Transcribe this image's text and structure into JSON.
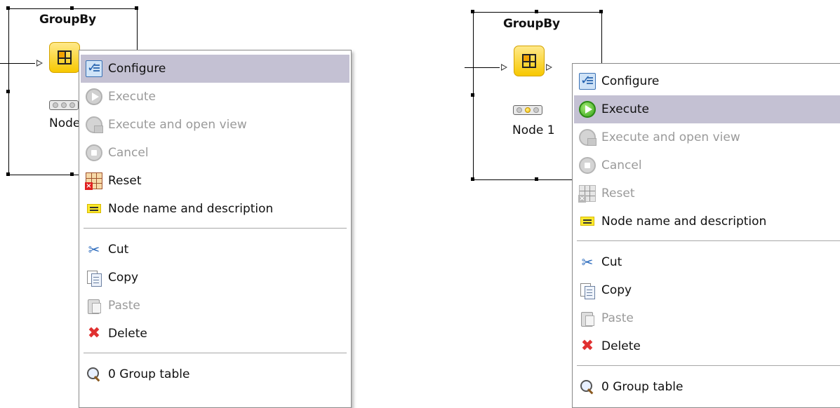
{
  "panels": [
    {
      "node": {
        "title": "GroupBy",
        "label": "Node",
        "status_lights": [
          "off",
          "off",
          "off"
        ]
      },
      "menu": {
        "items": [
          {
            "label": "Configure",
            "icon": "configure-icon",
            "enabled": true,
            "highlighted": true
          },
          {
            "label": "Execute",
            "icon": "execute-icon",
            "enabled": false,
            "highlighted": false
          },
          {
            "label": "Execute and open view",
            "icon": "execute-open-view-icon",
            "enabled": false,
            "highlighted": false
          },
          {
            "label": "Cancel",
            "icon": "cancel-icon",
            "enabled": false,
            "highlighted": false
          },
          {
            "label": "Reset",
            "icon": "reset-icon",
            "enabled": true,
            "highlighted": false
          },
          {
            "label": "Node name and description",
            "icon": "note-icon",
            "enabled": true,
            "highlighted": false
          },
          {
            "label": "Cut",
            "icon": "scissors-icon",
            "enabled": true,
            "highlighted": false
          },
          {
            "label": "Copy",
            "icon": "copy-icon",
            "enabled": true,
            "highlighted": false
          },
          {
            "label": "Paste",
            "icon": "paste-icon",
            "enabled": false,
            "highlighted": false
          },
          {
            "label": "Delete",
            "icon": "delete-icon",
            "enabled": true,
            "highlighted": false
          },
          {
            "label": "0 Group table",
            "icon": "magnifier-icon",
            "enabled": true,
            "highlighted": false
          }
        ]
      }
    },
    {
      "node": {
        "title": "GroupBy",
        "label": "Node 1",
        "status_lights": [
          "off",
          "yellow",
          "off"
        ]
      },
      "menu": {
        "items": [
          {
            "label": "Configure",
            "icon": "configure-icon",
            "enabled": true,
            "highlighted": false
          },
          {
            "label": "Execute",
            "icon": "execute-icon",
            "enabled": true,
            "highlighted": true
          },
          {
            "label": "Execute and open view",
            "icon": "execute-open-view-icon",
            "enabled": false,
            "highlighted": false
          },
          {
            "label": "Cancel",
            "icon": "cancel-icon",
            "enabled": false,
            "highlighted": false
          },
          {
            "label": "Reset",
            "icon": "reset-icon",
            "enabled": false,
            "highlighted": false
          },
          {
            "label": "Node name and description",
            "icon": "note-icon",
            "enabled": true,
            "highlighted": false
          },
          {
            "label": "Cut",
            "icon": "scissors-icon",
            "enabled": true,
            "highlighted": false
          },
          {
            "label": "Copy",
            "icon": "copy-icon",
            "enabled": true,
            "highlighted": false
          },
          {
            "label": "Paste",
            "icon": "paste-icon",
            "enabled": false,
            "highlighted": false
          },
          {
            "label": "Delete",
            "icon": "delete-icon",
            "enabled": true,
            "highlighted": false
          },
          {
            "label": "0 Group table",
            "icon": "magnifier-icon",
            "enabled": true,
            "highlighted": false
          }
        ]
      }
    }
  ],
  "colors": {
    "highlight": "#c4c1d3",
    "disabled_text": "#9a9a9a",
    "node_yellow": "#f7c800"
  }
}
